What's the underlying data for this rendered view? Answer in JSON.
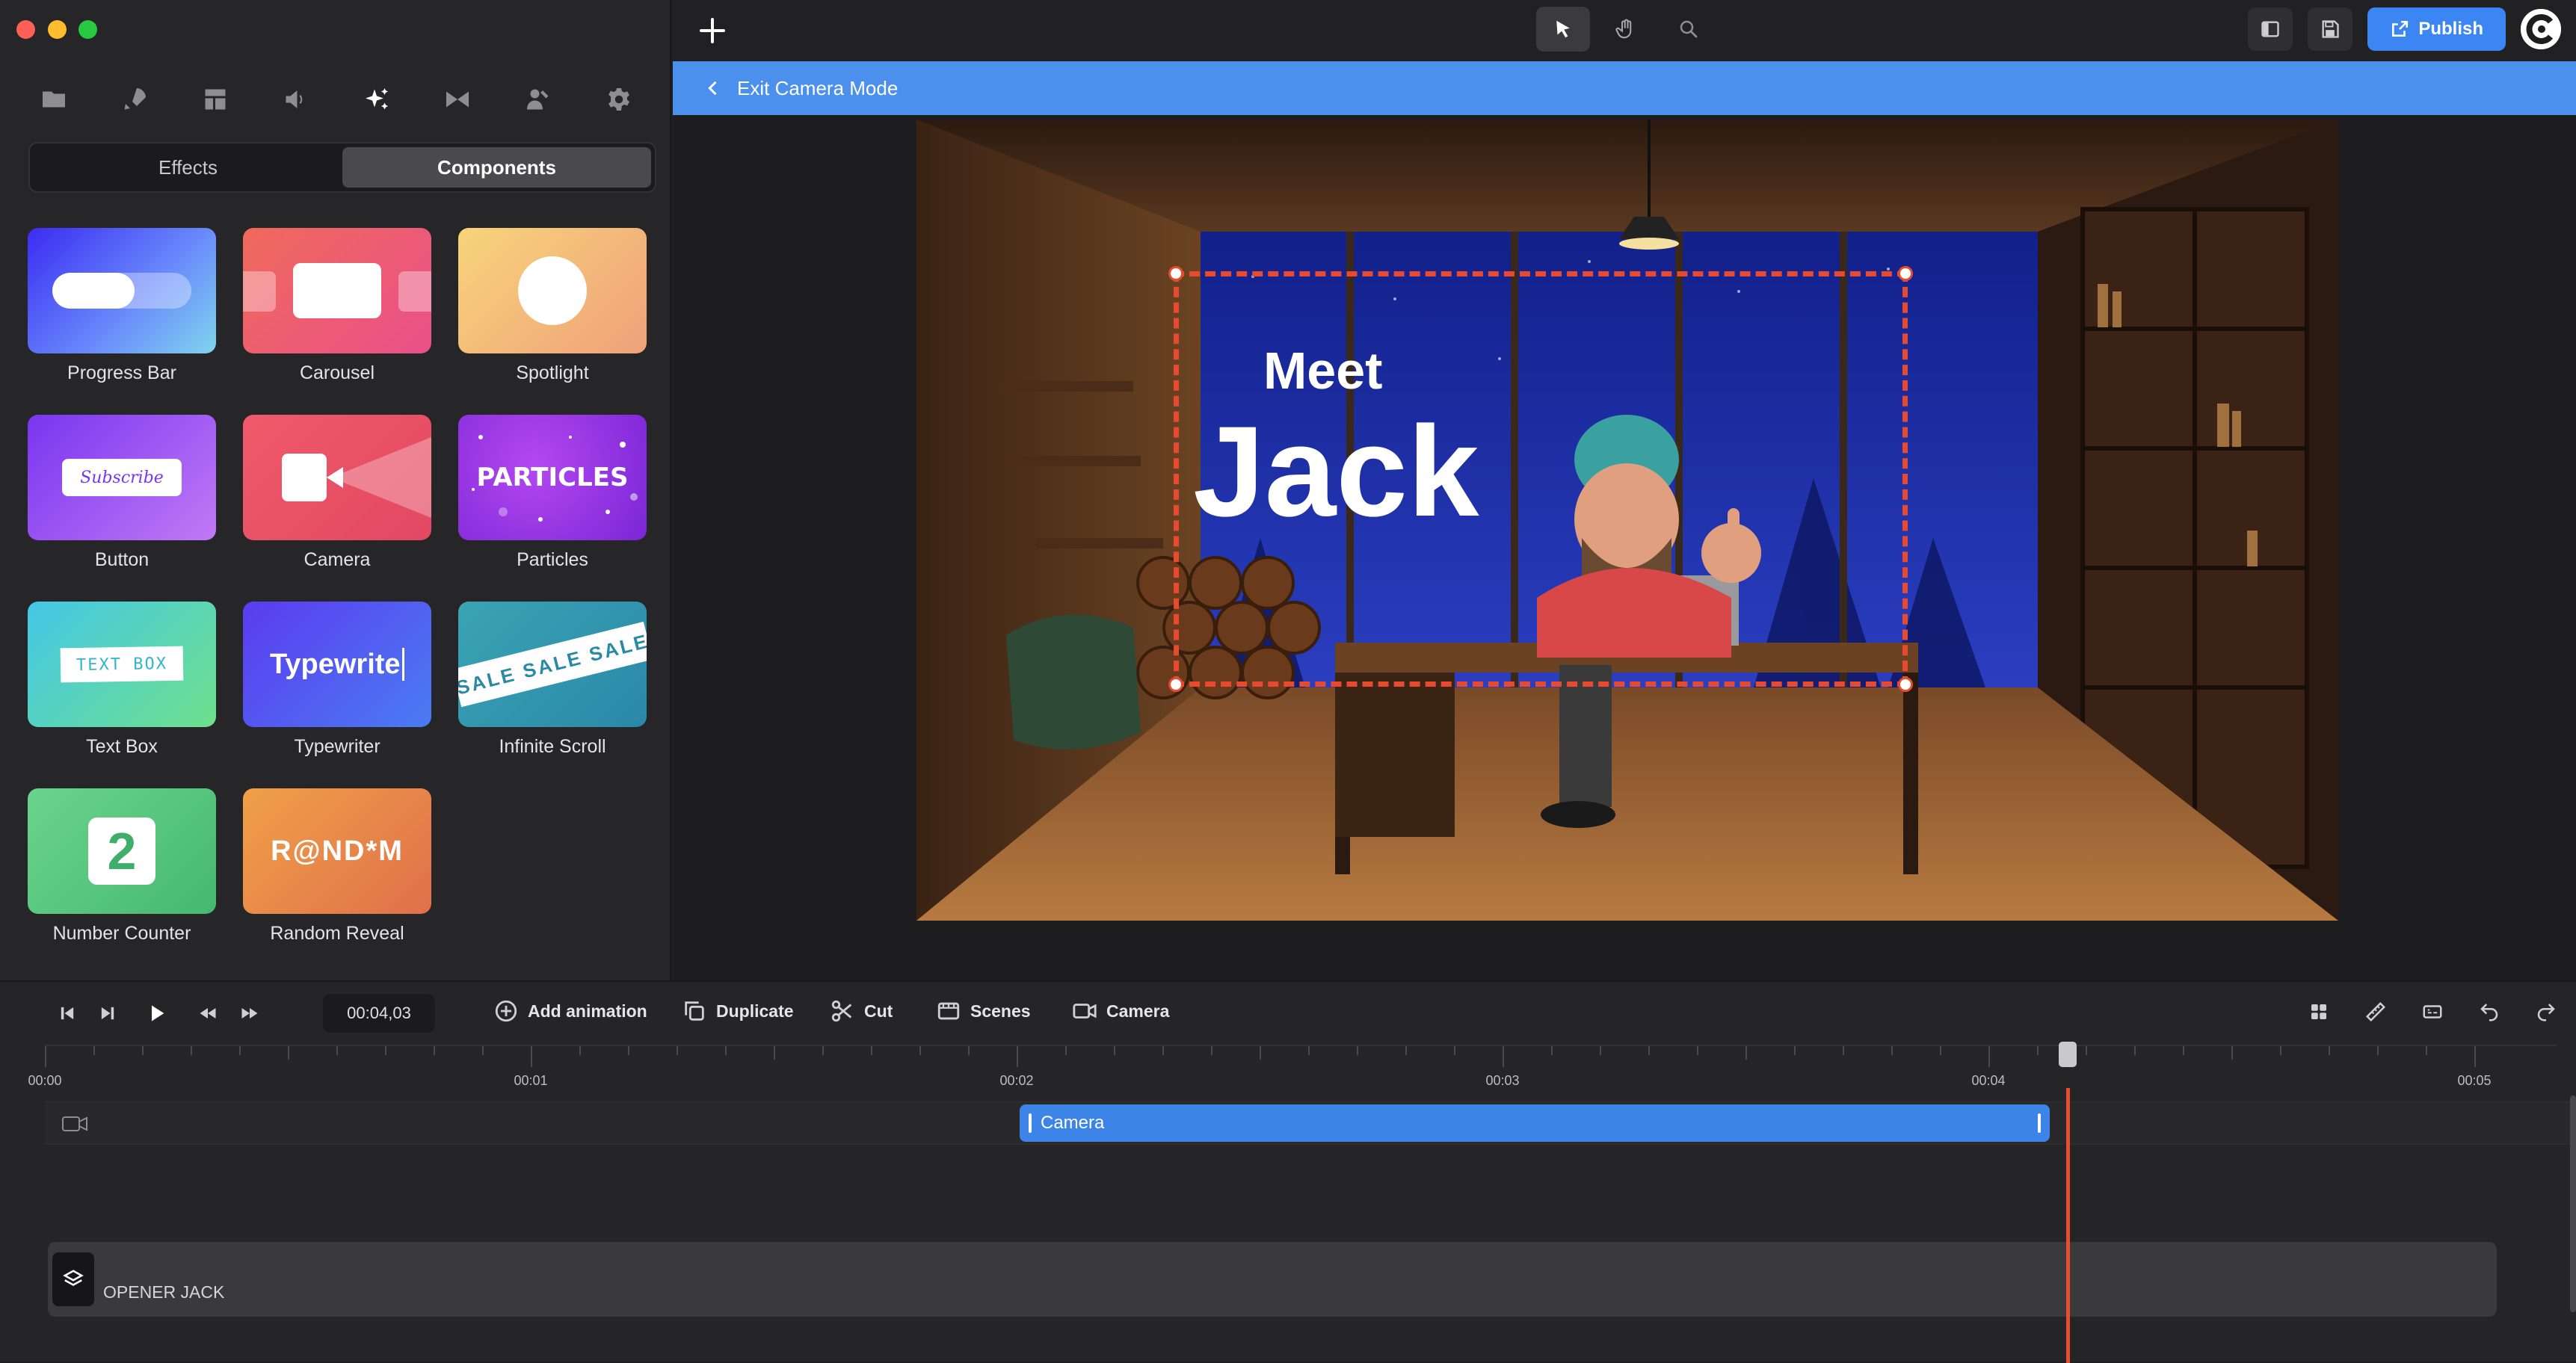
{
  "window": {
    "controls": [
      "close",
      "minimize",
      "maximize"
    ]
  },
  "sidebar": {
    "categories": [
      "folder-icon",
      "rocket-icon",
      "layout-icon",
      "speaker-icon",
      "sparkles-icon",
      "transition-icon",
      "person-icon",
      "gear-icon"
    ],
    "active_category": "sparkles-icon",
    "tabs": {
      "effects": "Effects",
      "components": "Components"
    },
    "active_tab": "Components",
    "components": [
      {
        "label": "Progress Bar"
      },
      {
        "label": "Carousel"
      },
      {
        "label": "Spotlight"
      },
      {
        "label": "Button",
        "thumb_text": "Subscribe"
      },
      {
        "label": "Camera"
      },
      {
        "label": "Particles",
        "thumb_text": "PARTICLES"
      },
      {
        "label": "Text Box",
        "thumb_text": "TEXT BOX"
      },
      {
        "label": "Typewriter",
        "thumb_text": "Typewrite"
      },
      {
        "label": "Infinite Scroll",
        "thumb_text": "SALE SALE SALE"
      },
      {
        "label": "Number Counter",
        "thumb_text": "2"
      },
      {
        "label": "Random Reveal",
        "thumb_text": "R@ND*M"
      }
    ]
  },
  "topbar": {
    "tools": [
      "pointer-icon",
      "hand-icon",
      "search-icon"
    ],
    "active_tool": "pointer-icon",
    "publish_label": "Publish"
  },
  "banner": {
    "exit_label": "Exit Camera Mode"
  },
  "scene": {
    "title_line1": "Meet",
    "title_line2": "Jack"
  },
  "timeline": {
    "timecode": "00:04,03",
    "actions": {
      "add_animation": "Add animation",
      "duplicate": "Duplicate",
      "cut": "Cut",
      "scenes": "Scenes",
      "camera": "Camera"
    },
    "ruler_labels": [
      "00:00",
      "00:01",
      "00:02",
      "00:03",
      "00:04",
      "00:05"
    ],
    "camera_clip_label": "Camera",
    "scene_track_label": "OPENER JACK"
  },
  "colors": {
    "accent": "#3b86f3",
    "banner": "#4a90ec",
    "playhead": "#e94d2f",
    "camera_frame": "#e84a2f"
  }
}
